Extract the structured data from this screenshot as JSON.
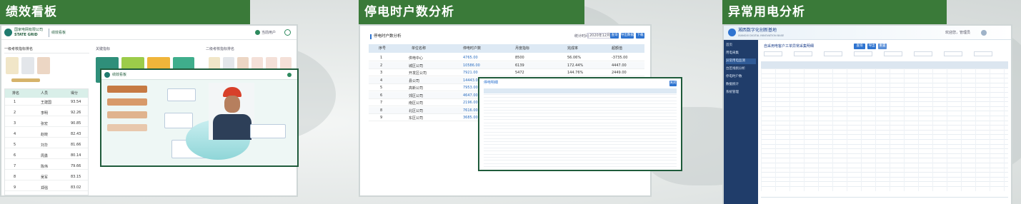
{
  "sections": {
    "performance": "绩效看板",
    "outage": "停电时户数分析",
    "anomaly": "异常用电分析"
  },
  "performance_panel": {
    "company": "国家电网有限公司",
    "company_en": "STATE GRID",
    "side_title": "绩效看板",
    "left_header": "一级考核指标排名",
    "mid_header": "关键指标",
    "right_header": "二级考核指标排名",
    "table_headers": [
      "排名",
      "人员",
      "得分"
    ],
    "table_rows": [
      {
        "rank": "1",
        "name": "王建国",
        "score": "93.54"
      },
      {
        "rank": "2",
        "name": "李明",
        "score": "92.26"
      },
      {
        "rank": "3",
        "name": "张宏",
        "score": "90.85"
      },
      {
        "rank": "4",
        "name": "赵晓",
        "score": "82.43"
      },
      {
        "rank": "5",
        "name": "刘华",
        "score": "81.66"
      },
      {
        "rank": "6",
        "name": "周勇",
        "score": "80.14"
      },
      {
        "rank": "7",
        "name": "陈伟",
        "score": "79.66"
      },
      {
        "rank": "8",
        "name": "吴军",
        "score": "83.15"
      },
      {
        "rank": "9",
        "name": "郑强",
        "score": "83.02"
      }
    ],
    "user_label": "当前用户"
  },
  "overlay_panel": {
    "title": "绩效看板"
  },
  "outage_panel": {
    "title": "停电时户数分析",
    "date_label": "统计时间",
    "date_value": "2020年12月",
    "buttons": [
      "查询",
      "导出数据",
      "下载"
    ],
    "headers": [
      "序号",
      "单位名称",
      "停电时户数",
      "月度指标",
      "完成率",
      "超额值"
    ],
    "rows": [
      {
        "no": "1",
        "unit": "供电中心",
        "hours": "4765.00",
        "target": "8500",
        "rate": "56.06%",
        "over": "-3735.00"
      },
      {
        "no": "2",
        "unit": "城区公司",
        "hours": "10586.00",
        "target": "6139",
        "rate": "172.44%",
        "over": "4447.00"
      },
      {
        "no": "3",
        "unit": "开发区公司",
        "hours": "7921.00",
        "target": "5472",
        "rate": "144.76%",
        "over": "2449.00"
      },
      {
        "no": "4",
        "unit": "县公司",
        "hours": "14443.00",
        "target": "",
        "rate": "",
        "over": ""
      },
      {
        "no": "5",
        "unit": "高新公司",
        "hours": "7953.00",
        "target": "",
        "rate": "",
        "over": ""
      },
      {
        "no": "6",
        "unit": "郊区公司",
        "hours": "4647.00",
        "target": "",
        "rate": "",
        "over": ""
      },
      {
        "no": "7",
        "unit": "南区公司",
        "hours": "2196.00",
        "target": "",
        "rate": "",
        "over": ""
      },
      {
        "no": "8",
        "unit": "北区公司",
        "hours": "7616.00",
        "target": "",
        "rate": "",
        "over": ""
      },
      {
        "no": "9",
        "unit": "东区公司",
        "hours": "3685.00",
        "target": "",
        "rate": "",
        "over": ""
      }
    ]
  },
  "detail_popup": {
    "title": "停电明细",
    "close": "关闭"
  },
  "anomaly_panel": {
    "brand": "湘西数字化创新基地",
    "brand_en": "XIANGXI DIGITAL INNOVATION BASE",
    "user": "欢迎您，管理员",
    "title": "自采用电客户工单异常采集明细",
    "buttons": [
      "查询",
      "导出",
      "重置"
    ],
    "sidebar": [
      "首页",
      "用电采集",
      "异常用电监测",
      "台区线损分析",
      "停电时户数",
      "数据统计",
      "系统管理"
    ]
  }
}
